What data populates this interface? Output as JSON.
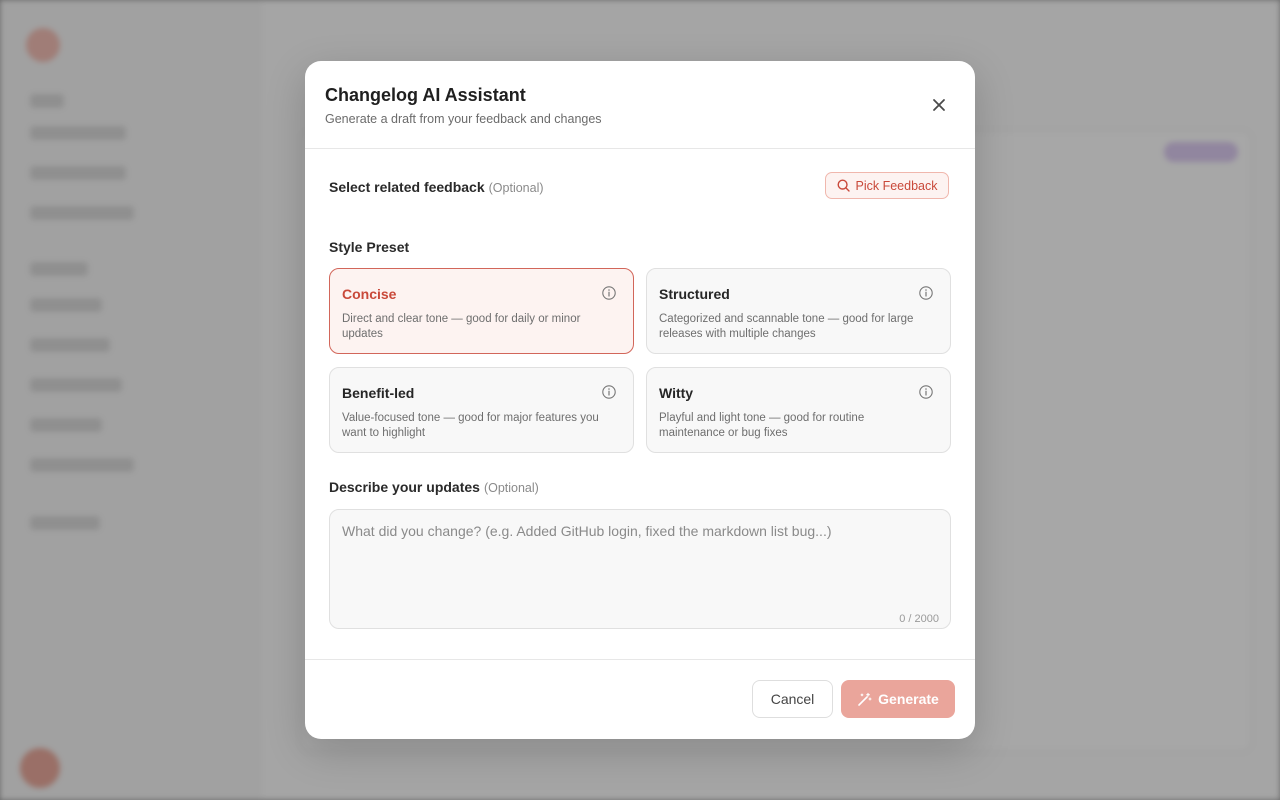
{
  "modal": {
    "title": "Changelog AI Assistant",
    "subtitle": "Generate a draft from your feedback and changes",
    "close_icon": "close-icon"
  },
  "feedback": {
    "label": "Select related feedback",
    "optional": "(Optional)",
    "pick_button": "Pick Feedback",
    "pick_icon": "search-icon"
  },
  "style_preset": {
    "label": "Style Preset",
    "selected": "Concise",
    "options": [
      {
        "title": "Concise",
        "description": "Direct and clear tone — good for daily or minor updates"
      },
      {
        "title": "Structured",
        "description": "Categorized and scannable tone — good for large releases with multiple changes"
      },
      {
        "title": "Benefit-led",
        "description": "Value-focused tone — good for major features you want to highlight"
      },
      {
        "title": "Witty",
        "description": "Playful and light tone — good for routine maintenance or bug fixes"
      }
    ]
  },
  "updates": {
    "label": "Describe your updates",
    "optional": "(Optional)",
    "value": "",
    "placeholder": "What did you change? (e.g. Added GitHub login, fixed the markdown list bug...)",
    "counter": "0 / 2000"
  },
  "footer": {
    "cancel": "Cancel",
    "generate": "Generate",
    "generate_icon": "magic-wand-icon"
  },
  "colors": {
    "accent": "#c9493a",
    "accent_bg": "#fdf3f1",
    "generate_disabled": "#eaa59b"
  }
}
